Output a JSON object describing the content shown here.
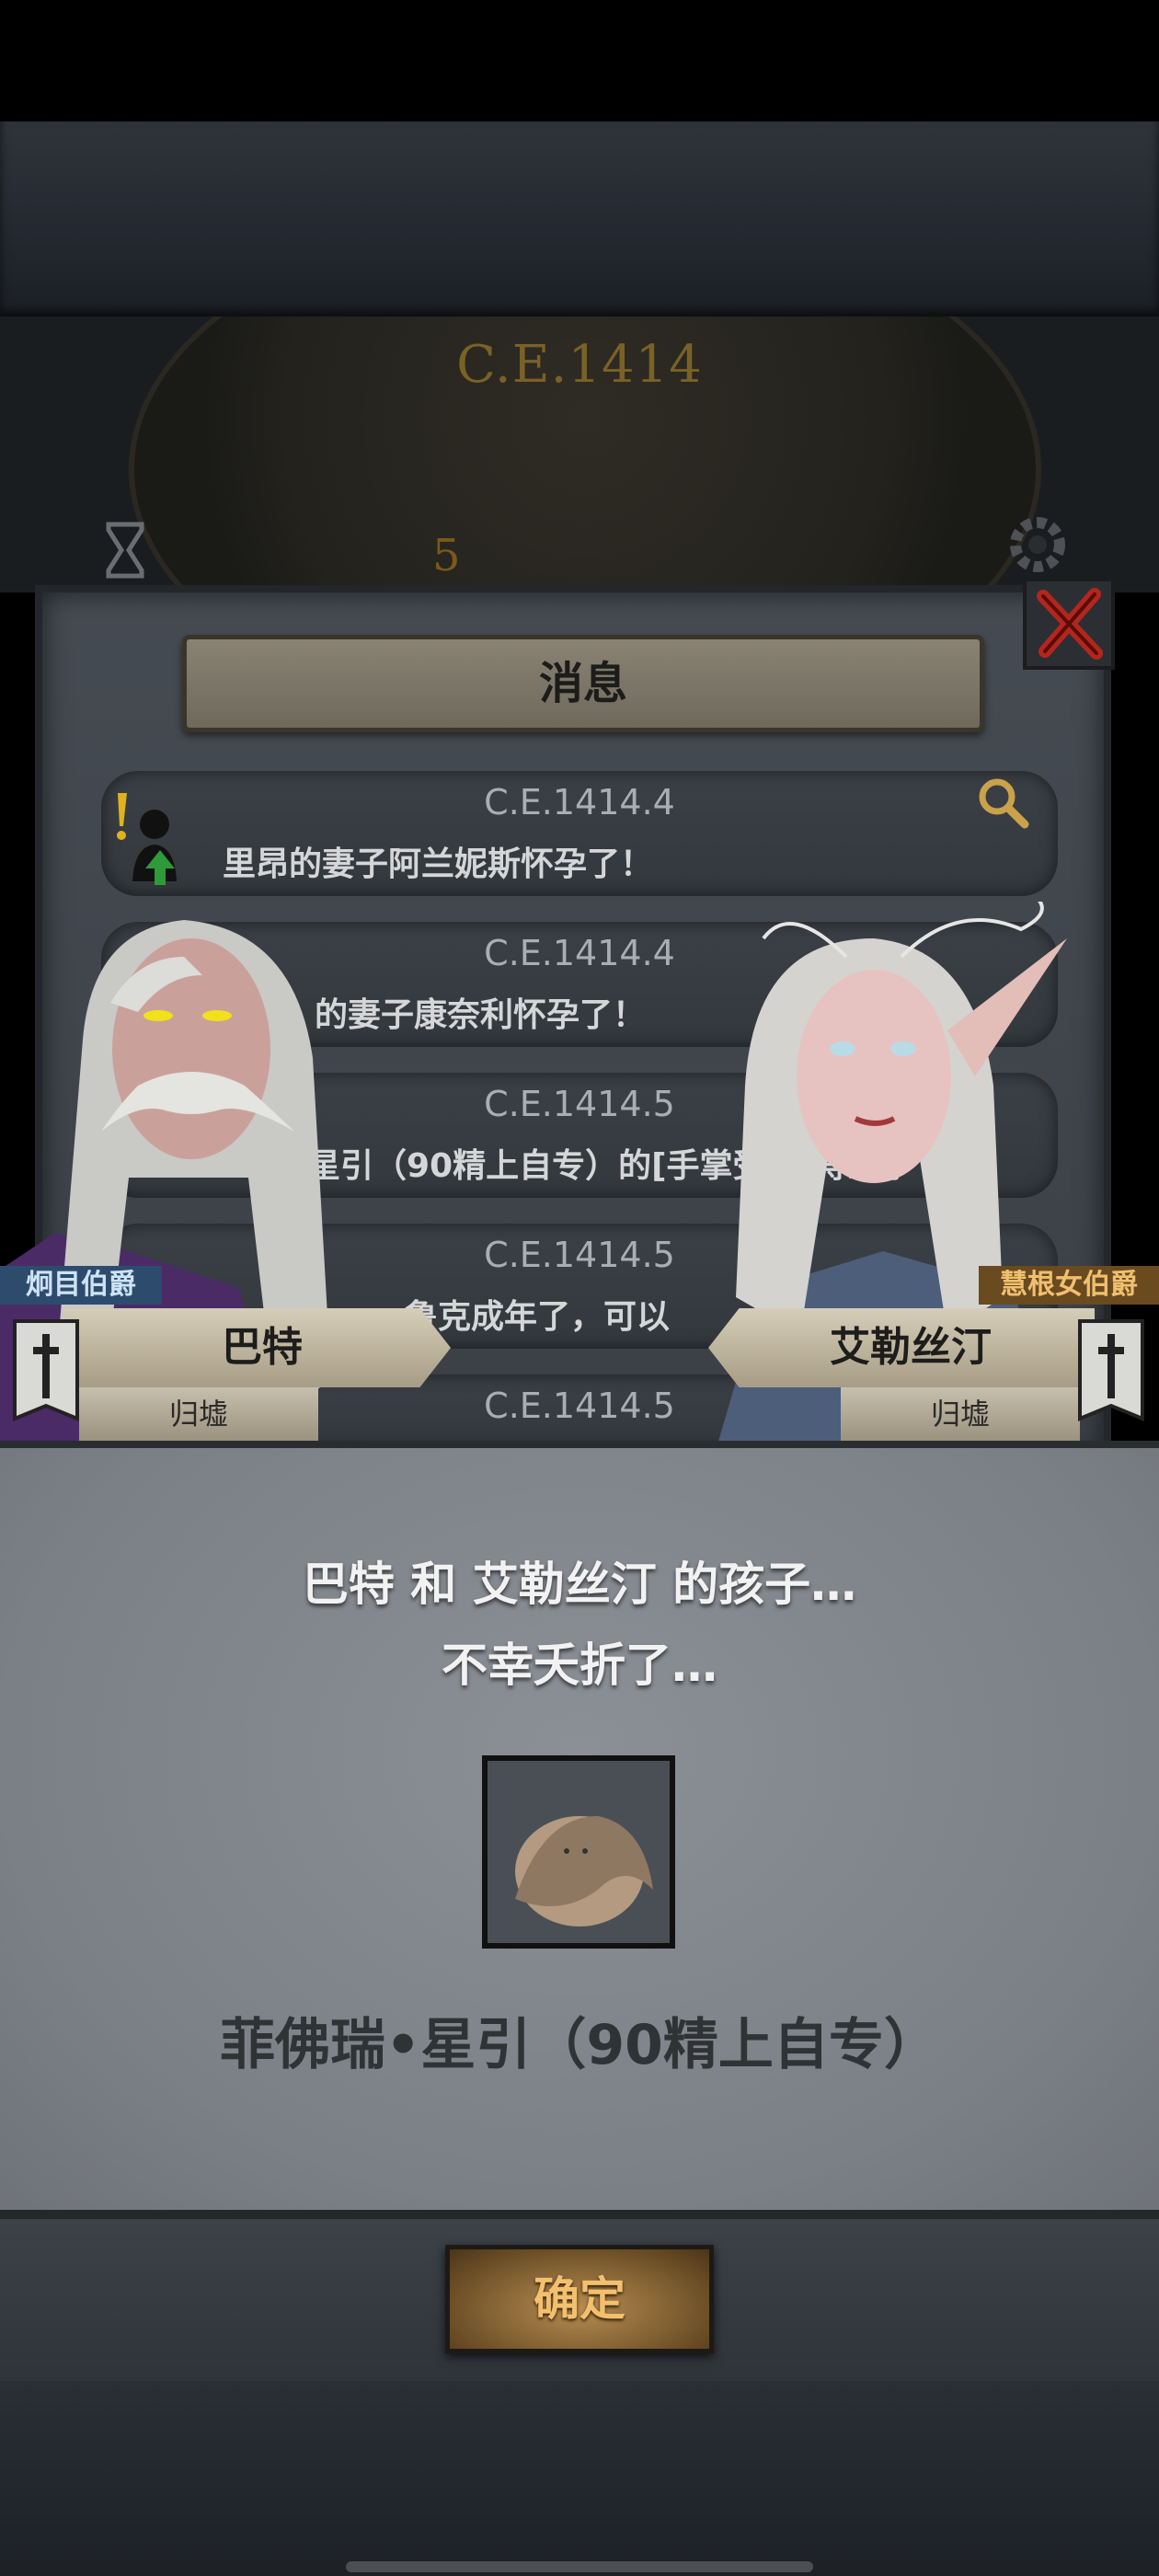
{
  "clock": {
    "year": "C.E.1414",
    "hour_mark": "5"
  },
  "message_panel": {
    "title": "消息",
    "items": [
      {
        "date": "C.E.1414.4",
        "text": "里昂的妻子阿兰妮斯怀孕了！"
      },
      {
        "date": "C.E.1414.4",
        "text": "的妻子康奈利怀孕了！"
      },
      {
        "date": "C.E.1414.5",
        "text": "星引（90精上自专）的[手掌受伤]得到了"
      },
      {
        "date": "C.E.1414.5",
        "text": "鲁克成年了，可以"
      },
      {
        "date": "C.E.1414.5",
        "text": ""
      }
    ]
  },
  "left_character": {
    "title": "炯目伯爵",
    "name": "巴特",
    "status": "归墟",
    "title_color": "#2d4c6d"
  },
  "right_character": {
    "title": "慧根女伯爵",
    "name": "艾勒丝汀",
    "status": "归墟",
    "title_color": "#6a4a1f"
  },
  "dialog": {
    "line1": "巴特 和 艾勒丝汀 的孩子…",
    "line2": "不幸夭折了…",
    "child_name": "菲佛瑞•星引（90精上自专）"
  },
  "confirm": {
    "label": "确定"
  },
  "colors": {
    "accent": "#f3c06f",
    "panel": "#7b8086"
  },
  "icons": [
    "hourglass-icon",
    "gear-icon",
    "close-icon",
    "search-icon",
    "alert-icon",
    "banner-flag-icon",
    "baby-icon"
  ]
}
